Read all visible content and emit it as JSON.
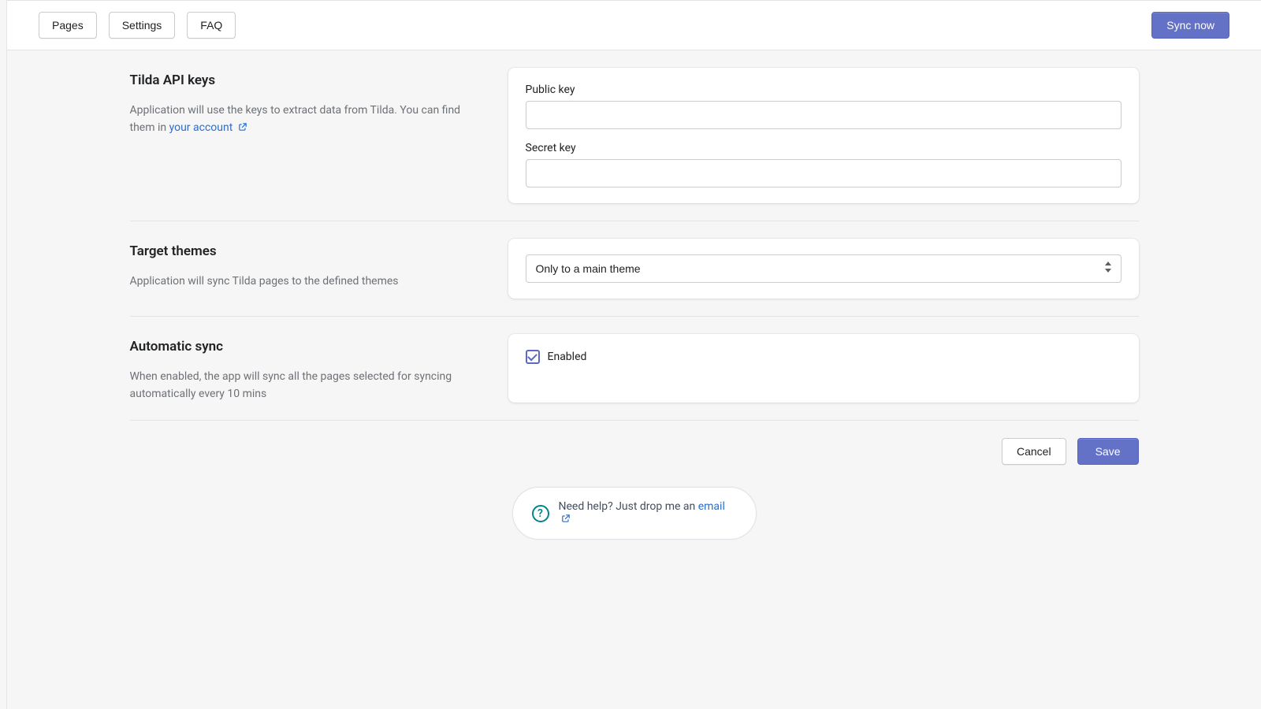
{
  "topbar": {
    "tabs": {
      "pages": "Pages",
      "settings": "Settings",
      "faq": "FAQ"
    },
    "sync_now": "Sync now"
  },
  "sections": {
    "api_keys": {
      "title": "Tilda API keys",
      "desc": "Application will use the keys to extract data from Tilda. You can find them in ",
      "link_text": "your account",
      "public_key_label": "Public key",
      "public_key_value": "",
      "secret_key_label": "Secret key",
      "secret_key_value": ""
    },
    "target_themes": {
      "title": "Target themes",
      "desc": "Application will sync Tilda pages to the defined themes",
      "selected": "Only to a main theme"
    },
    "auto_sync": {
      "title": "Automatic sync",
      "desc": "When enabled, the app will sync all the pages selected for syncing automatically every 10 mins",
      "enabled_label": "Enabled",
      "enabled_checked": true
    }
  },
  "footer": {
    "cancel": "Cancel",
    "save": "Save"
  },
  "help": {
    "text": "Need help? Just drop me an ",
    "link_text": "email"
  }
}
